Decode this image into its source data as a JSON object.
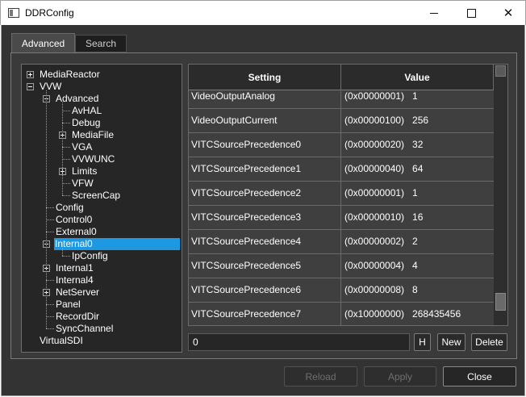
{
  "window": {
    "title": "DDRConfig",
    "minimize_glyph": "",
    "maximize_glyph": "",
    "close_glyph": "✕"
  },
  "tabs": [
    {
      "label": "Advanced",
      "active": true
    },
    {
      "label": "Search",
      "active": false
    }
  ],
  "tree": {
    "nodes": [
      {
        "label": "MediaReactor",
        "level": 0,
        "expander": "plus"
      },
      {
        "label": "VVW",
        "level": 0,
        "expander": "minus"
      },
      {
        "label": "Advanced",
        "level": 1,
        "expander": "minus"
      },
      {
        "label": "AvHAL",
        "level": 2,
        "expander": "none"
      },
      {
        "label": "Debug",
        "level": 2,
        "expander": "none"
      },
      {
        "label": "MediaFile",
        "level": 2,
        "expander": "plus"
      },
      {
        "label": "VGA",
        "level": 2,
        "expander": "none"
      },
      {
        "label": "VVWUNC",
        "level": 2,
        "expander": "none"
      },
      {
        "label": "Limits",
        "level": 2,
        "expander": "plus"
      },
      {
        "label": "VFW",
        "level": 2,
        "expander": "none"
      },
      {
        "label": "ScreenCap",
        "level": 2,
        "expander": "none"
      },
      {
        "label": "Config",
        "level": 1,
        "expander": "none"
      },
      {
        "label": "Control0",
        "level": 1,
        "expander": "none"
      },
      {
        "label": "External0",
        "level": 1,
        "expander": "none"
      },
      {
        "label": "Internal0",
        "level": 1,
        "expander": "minus",
        "selected": true
      },
      {
        "label": "IpConfig",
        "level": 2,
        "expander": "none"
      },
      {
        "label": "Internal1",
        "level": 1,
        "expander": "plus"
      },
      {
        "label": "Internal4",
        "level": 1,
        "expander": "none"
      },
      {
        "label": "NetServer",
        "level": 1,
        "expander": "plus"
      },
      {
        "label": "Panel",
        "level": 1,
        "expander": "none"
      },
      {
        "label": "RecordDir",
        "level": 1,
        "expander": "none"
      },
      {
        "label": "SyncChannel",
        "level": 1,
        "expander": "none"
      },
      {
        "label": "VirtualSDI",
        "level": 0,
        "expander": "none"
      }
    ]
  },
  "table": {
    "columns": [
      "Setting",
      "Value"
    ],
    "rows": [
      {
        "setting": "VideoOutputAnalog",
        "value": "(0x00000001)   1"
      },
      {
        "setting": "VideoOutputCurrent",
        "value": "(0x00000100)   256"
      },
      {
        "setting": "VITCSourcePrecedence0",
        "value": "(0x00000020)   32"
      },
      {
        "setting": "VITCSourcePrecedence1",
        "value": "(0x00000040)   64"
      },
      {
        "setting": "VITCSourcePrecedence2",
        "value": "(0x00000001)   1"
      },
      {
        "setting": "VITCSourcePrecedence3",
        "value": "(0x00000010)   16"
      },
      {
        "setting": "VITCSourcePrecedence4",
        "value": "(0x00000002)   2"
      },
      {
        "setting": "VITCSourcePrecedence5",
        "value": "(0x00000004)   4"
      },
      {
        "setting": "VITCSourcePrecedence6",
        "value": "(0x00000008)   8"
      },
      {
        "setting": "VITCSourcePrecedence7",
        "value": "(0x10000000)   268435456"
      }
    ]
  },
  "editor": {
    "value": "0",
    "h_label": "H",
    "new_label": "New",
    "delete_label": "Delete"
  },
  "footer": {
    "reload_label": "Reload",
    "apply_label": "Apply",
    "close_label": "Close"
  },
  "colors": {
    "background": "#333333",
    "selection": "#1e98e0"
  }
}
